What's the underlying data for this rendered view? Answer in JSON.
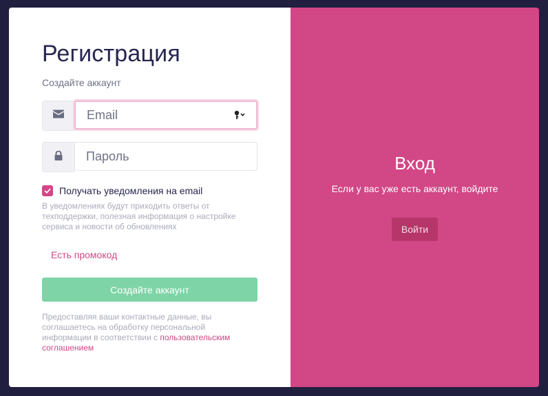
{
  "register": {
    "title": "Регистрация",
    "subtitle": "Создайте аккаунт",
    "email_placeholder": "Email",
    "password_placeholder": "Пароль",
    "notify_label": "Получать уведомления на email",
    "notify_checked": true,
    "notify_hint": "В уведомлениях будут приходить ответы от техподдержки, полезная информация о настройке сервиса и новости об обновлениях",
    "promo_link": "Есть промокод",
    "submit_label": "Создайте аккаунт",
    "legal_text": "Предоставляя ваши контактные данные, вы соглашаетесь на обработку персональной информации в соответствии с ",
    "legal_link": "пользовательским соглашением"
  },
  "login": {
    "title": "Вход",
    "text": "Если у вас уже есть аккаунт, войдите",
    "button_label": "Войти"
  },
  "icons": {
    "email": "envelope-icon",
    "password": "lock-icon",
    "autofill": "key-icon",
    "checkbox": "checkmark-icon"
  },
  "colors": {
    "accent": "#d24786",
    "submit": "#7ed4a6",
    "background": "#211f3f"
  }
}
